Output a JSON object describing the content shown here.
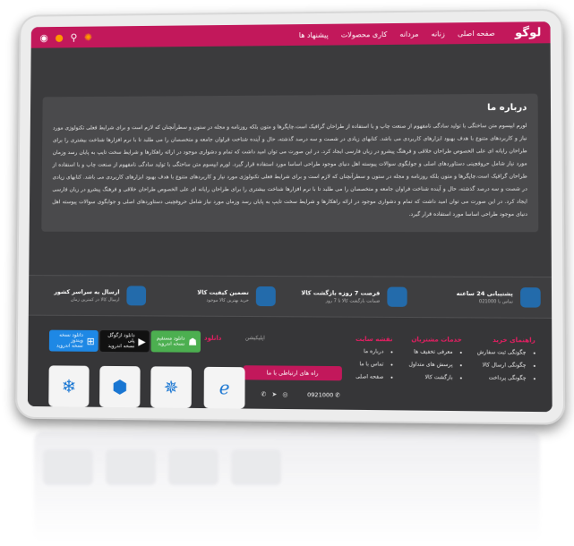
{
  "nav": {
    "logo": "لوگو",
    "menu": [
      "صفحه اصلی",
      "زنانه",
      "مردانه",
      "کاری محصولات",
      "پیشنهاد ها"
    ]
  },
  "about": {
    "title": "درباره ما",
    "text": "لورم ایپسوم متن ساختگی با تولید سادگی نامفهوم از صنعت چاپ و با استفاده از طراحان گرافیک است.چاپگرها و متون بلکه روزنامه و مجله در ستون و سطرآنچنان که لازم است و برای شرایط فعلی تکنولوژی مورد نیاز و کاربردهای متنوع با هدف بهبود ابزارهای کاربردی می باشد. کتابهای زیادی در شصت و سه درصد گذشته، حال و آینده شناخت فراوان جامعه و متخصصان را می طلبد تا با نرم افزارها شناخت بیشتری را برای طراحان رایانه ای علی الخصوص طراحان خلاقی و فرهنگ پیشرو در زبان فارسی ایجاد کرد. در این صورت می توان امید داشت که تمام و دشواری موجود در ارائه راهکارها و شرایط سخت تایپ به پایان رسد وزمان مورد نیاز شامل حروفچینی دستاوردهای اصلی و جوابگوی سوالات پیوسته اهل دنیای موجود طراحی اساسا مورد استفاده قرار گیرد. لورم ایپسوم متن ساختگی با تولید سادگی نامفهوم از صنعت چاپ و با استفاده از طراحان گرافیک است.چاپگرها و متون بلکه روزنامه و مجله در ستون و سطرآنچنان که لازم است و برای شرایط فعلی تکنولوژی مورد نیاز و کاربردهای متنوع با هدف بهبود ابزارهای کاربردی می باشد. کتابهای زیادی در شصت و سه درصد گذشته، حال و آینده شناخت فراوان جامعه و متخصصان را می طلبد تا با نرم افزارها شناخت بیشتری را برای طراحان رایانه ای علی الخصوص طراحان خلاقی و فرهنگ پیشرو در زبان فارسی ایجاد کرد. در این صورت می توان امید داشت که تمام و دشواری موجود در ارائه راهکارها و شرایط سخت تایپ به پایان رسد وزمان مورد نیاز شامل حروفچینی دستاوردهای اصلی و جوابگوی سوالات پیوسته اهل دنیای موجود طراحی اساسا مورد استفاده قرار گیرد."
  },
  "features": [
    {
      "title": "پشتیبانی 24 ساعته",
      "sub": "تماس با 021000"
    },
    {
      "title": "فرصت 7 روزه بازگشت کالا",
      "sub": "ضمانت بازگشت کالا تا 7 روز"
    },
    {
      "title": "تضمین کیفیت کالا",
      "sub": "خرید بهترین کالا موجود"
    },
    {
      "title": "ارسال به سراسر کشور",
      "sub": "ارسال کالا در کمترین زمان"
    }
  ],
  "footer": {
    "guide": {
      "title": "راهنمای خرید",
      "items": [
        "چگونگی ثبت سفارش",
        "چگونگی ارسال کالا",
        "چگونگی پرداخت"
      ]
    },
    "customers": {
      "title": "خدمات مشتریان",
      "items": [
        "معرفی تخفیف ها",
        "پرسش های متداول",
        "بازگشت کالا"
      ]
    },
    "sitemap": {
      "title": "نقشه سایت",
      "items": [
        "درباره ما",
        "تماس با ما",
        "صفحه اصلی"
      ]
    },
    "contact_button": "راه های ارتباطی با ما",
    "phone": "0921000",
    "download_title": "دانلود",
    "download_sub": "اپلیکیشن",
    "apps": [
      {
        "label": "دانلود مستقیم",
        "sub": "نسخه اندروید"
      },
      {
        "label": "دانلود ازگوگل پلی",
        "sub": "نسخه اندروید"
      },
      {
        "label": "دانلود نسخه ویندوز",
        "sub": "نسخه اندروید"
      }
    ]
  }
}
